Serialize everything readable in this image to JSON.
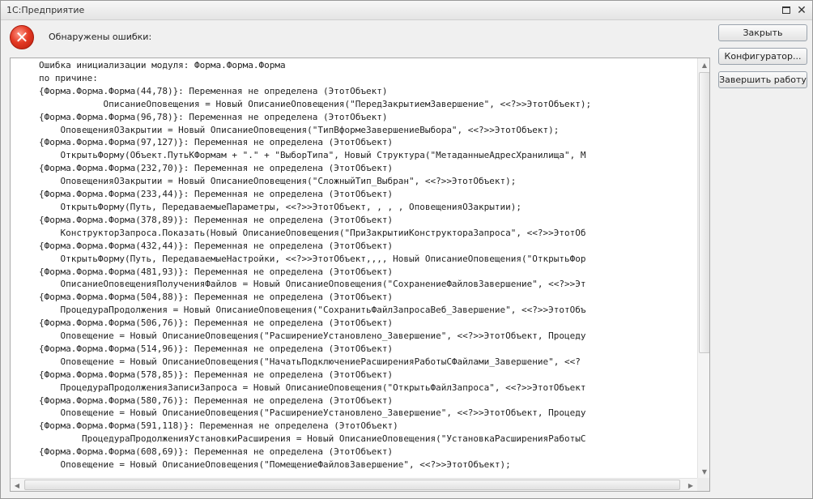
{
  "window": {
    "title": "1С:Предприятие",
    "maximize_icon": "maximize-icon",
    "close_icon": "close-icon"
  },
  "header": {
    "error_icon": "error-circle-x-icon",
    "message": "Обнаружены ошибки:"
  },
  "buttons": {
    "close": "Закрыть",
    "configurator": "Конфигуратор...",
    "exit": "Завершить работу"
  },
  "error_text": [
    "Ошибка инициализации модуля: Форма.Форма.Форма",
    "по причине:",
    "{Форма.Форма.Форма(44,78)}: Переменная не определена (ЭтотОбъект)",
    "            ОписаниеОповещения = Новый ОписаниеОповещения(\"ПередЗакрытиемЗавершение\", <<?>>ЭтотОбъект);",
    "{Форма.Форма.Форма(96,78)}: Переменная не определена (ЭтотОбъект)",
    "    ОповещенияОЗакрытии = Новый ОписаниеОповещения(\"ТипВформеЗавершениеВыбора\", <<?>>ЭтотОбъект);",
    "{Форма.Форма.Форма(97,127)}: Переменная не определена (ЭтотОбъект)",
    "    ОткрытьФорму(Объект.ПутьКФормам + \".\" + \"ВыборТипа\", Новый Структура(\"МетаданныеАдресХранилища\", М",
    "{Форма.Форма.Форма(232,70)}: Переменная не определена (ЭтотОбъект)",
    "    ОповещенияОЗакрытии = Новый ОписаниеОповещения(\"СложныйТип_Выбран\", <<?>>ЭтотОбъект);",
    "{Форма.Форма.Форма(233,44)}: Переменная не определена (ЭтотОбъект)",
    "    ОткрытьФорму(Путь, ПередаваемыеПараметры, <<?>>ЭтотОбъект, , , , ОповещенияОЗакрытии);",
    "{Форма.Форма.Форма(378,89)}: Переменная не определена (ЭтотОбъект)",
    "    КонструкторЗапроса.Показать(Новый ОписаниеОповещения(\"ПриЗакрытииКонструктораЗапроса\", <<?>>ЭтотОб",
    "{Форма.Форма.Форма(432,44)}: Переменная не определена (ЭтотОбъект)",
    "    ОткрытьФорму(Путь, ПередаваемыеНастройки, <<?>>ЭтотОбъект,,,, Новый ОписаниеОповещения(\"ОткрытьФор",
    "{Форма.Форма.Форма(481,93)}: Переменная не определена (ЭтотОбъект)",
    "    ОписаниеОповещенияПолученияФайлов = Новый ОписаниеОповещения(\"СохранениеФайловЗавершение\", <<?>>Эт",
    "{Форма.Форма.Форма(504,88)}: Переменная не определена (ЭтотОбъект)",
    "    ПроцедураПродолжения = Новый ОписаниеОповещения(\"СохранитьФайлЗапросаВеб_Завершение\", <<?>>ЭтотОбъ",
    "{Форма.Форма.Форма(506,76)}: Переменная не определена (ЭтотОбъект)",
    "    Оповещение = Новый ОписаниеОповещения(\"РасширениеУстановлено_Завершение\", <<?>>ЭтотОбъект, Процеду",
    "{Форма.Форма.Форма(514,96)}: Переменная не определена (ЭтотОбъект)",
    "    Оповещение = Новый ОписаниеОповещения(\"НачатьПодключениеРасширенияРаботыСФайлами_Завершение\", <<?",
    "{Форма.Форма.Форма(578,85)}: Переменная не определена (ЭтотОбъект)",
    "    ПроцедураПродолженияЗаписиЗапроса = Новый ОписаниеОповещения(\"ОткрытьФайлЗапроса\", <<?>>ЭтотОбъект",
    "{Форма.Форма.Форма(580,76)}: Переменная не определена (ЭтотОбъект)",
    "    Оповещение = Новый ОписаниеОповещения(\"РасширениеУстановлено_Завершение\", <<?>>ЭтотОбъект, Процеду",
    "{Форма.Форма.Форма(591,118)}: Переменная не определена (ЭтотОбъект)",
    "        ПроцедураПродолженияУстановкиРасширения = Новый ОписаниеОповещения(\"УстановкаРасширенияРаботыС",
    "{Форма.Форма.Форма(608,69)}: Переменная не определена (ЭтотОбъект)",
    "    Оповещение = Новый ОписаниеОповещения(\"ПомещениеФайловЗавершение\", <<?>>ЭтотОбъект);"
  ],
  "scrollbars": {
    "up_icon": "scroll-up-arrow-icon",
    "down_icon": "scroll-down-arrow-icon",
    "left_icon": "scroll-left-arrow-icon",
    "right_icon": "scroll-right-arrow-icon"
  }
}
